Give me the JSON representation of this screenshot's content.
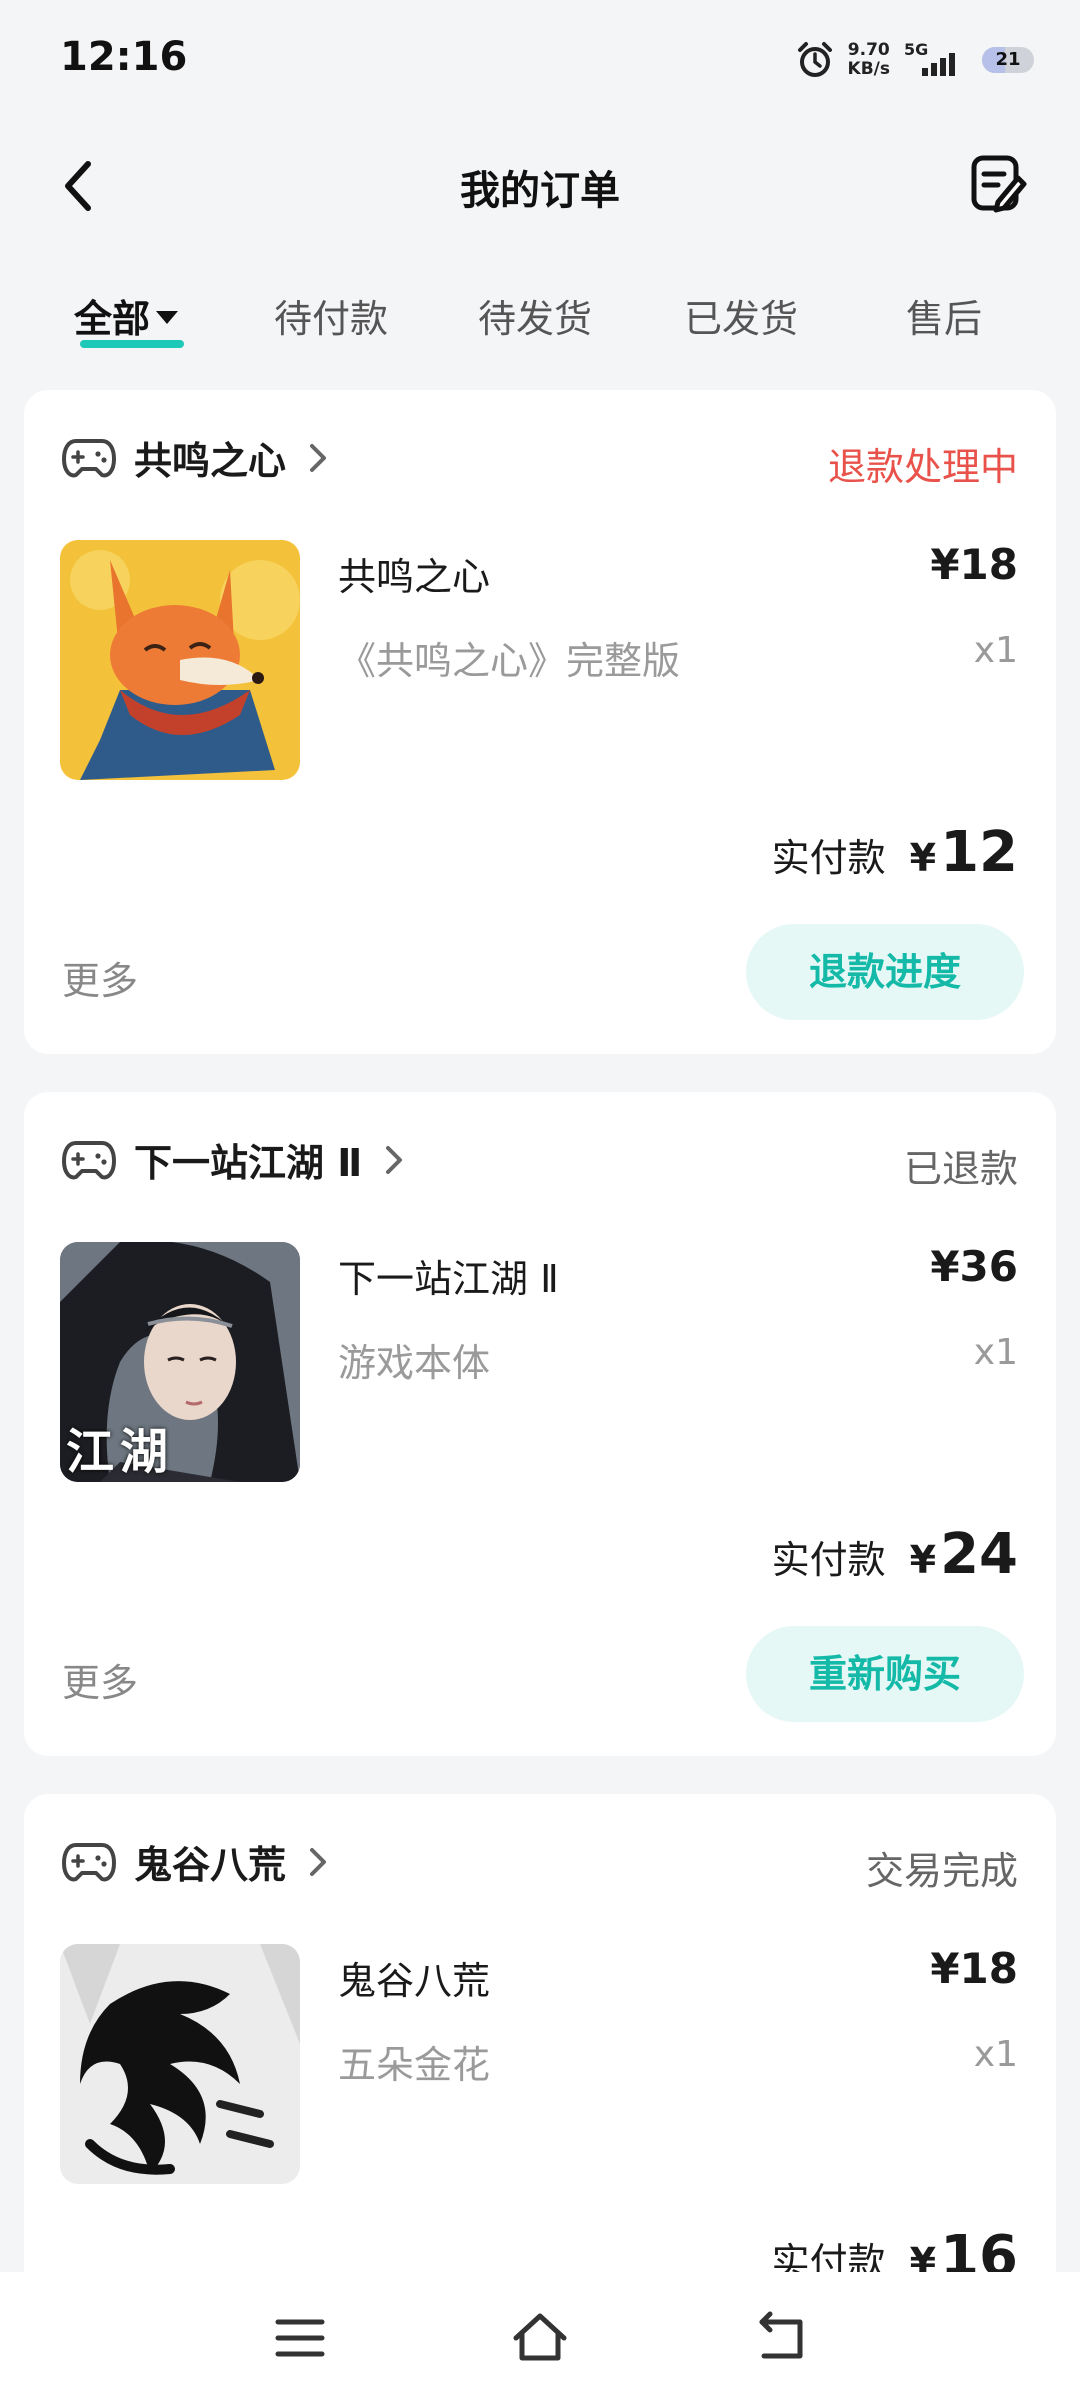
{
  "status_bar": {
    "time": "12:16",
    "speed_value": "9.70",
    "speed_unit": "KB/s",
    "network": "5G",
    "battery": "21",
    "icons": [
      "alarm-icon",
      "signal-icon",
      "battery-icon"
    ]
  },
  "header": {
    "title": "我的订单",
    "icons": [
      "back-icon",
      "order-edit-icon"
    ]
  },
  "tabs": [
    {
      "label": "全部",
      "active": true
    },
    {
      "label": "待付款"
    },
    {
      "label": "待发货"
    },
    {
      "label": "已发货"
    },
    {
      "label": "售后"
    }
  ],
  "orders": [
    {
      "store": "共鸣之心",
      "status": "退款处理中",
      "product_name": "共鸣之心",
      "product_sub": "《共鸣之心》完整版",
      "price": "¥18",
      "qty": "x1",
      "paid_label": "实付款",
      "paid_currency": "¥",
      "paid_amount": "12",
      "more": "更多",
      "action": "退款进度"
    },
    {
      "store": "下一站江湖 Ⅱ",
      "status": "已退款",
      "product_name": "下一站江湖 Ⅱ",
      "product_sub": "游戏本体",
      "price": "¥36",
      "qty": "x1",
      "paid_label": "实付款",
      "paid_currency": "¥",
      "paid_amount": "24",
      "more": "更多",
      "action": "重新购买",
      "thumb_text": "江湖"
    },
    {
      "store": "鬼谷八荒",
      "status": "交易完成",
      "product_name": "鬼谷八荒",
      "product_sub": "五朵金花",
      "price": "¥18",
      "qty": "x1",
      "paid_label": "实付款",
      "paid_currency": "¥",
      "paid_amount": "16"
    }
  ],
  "nav_icons": [
    "menu-icon",
    "home-icon",
    "back-nav-icon"
  ],
  "colors": {
    "accent": "#1ec9b8",
    "refund": "#e8524a",
    "button_bg": "#e5f8f6",
    "button_text": "#15b9a8"
  }
}
